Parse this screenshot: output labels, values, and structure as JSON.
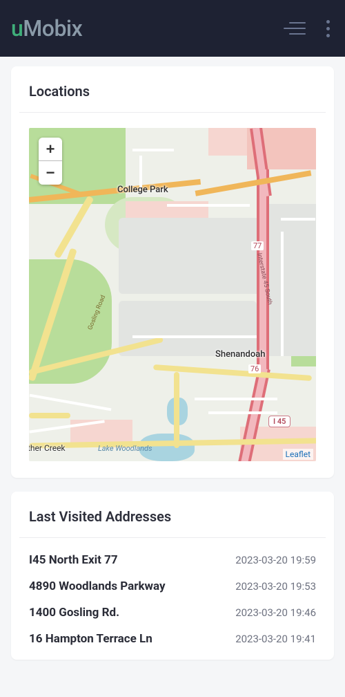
{
  "brand": {
    "u": "u",
    "mobix": "Mobix"
  },
  "locations": {
    "title": "Locations",
    "map": {
      "labels": {
        "college_park": "College Park",
        "shenandoah": "Shenandoah",
        "panther_creek": "ther Creek",
        "gosling_road": "Gosling Road",
        "i45_name": "Interstate 45 South",
        "lake": "Lake Woodlands",
        "shield_i45": "I 45",
        "num_77": "77",
        "num_76": "76"
      },
      "zoom_in": "+",
      "zoom_out": "−",
      "attribution": "Leaflet"
    }
  },
  "lastVisited": {
    "title": "Last Visited Addresses",
    "rows": [
      {
        "addr": "I45 North Exit 77",
        "time": "2023-03-20 19:59"
      },
      {
        "addr": "4890 Woodlands Parkway",
        "time": "2023-03-20 19:53"
      },
      {
        "addr": "1400 Gosling Rd.",
        "time": "2023-03-20 19:46"
      },
      {
        "addr": "16 Hampton Terrace Ln",
        "time": "2023-03-20 19:41"
      }
    ]
  }
}
